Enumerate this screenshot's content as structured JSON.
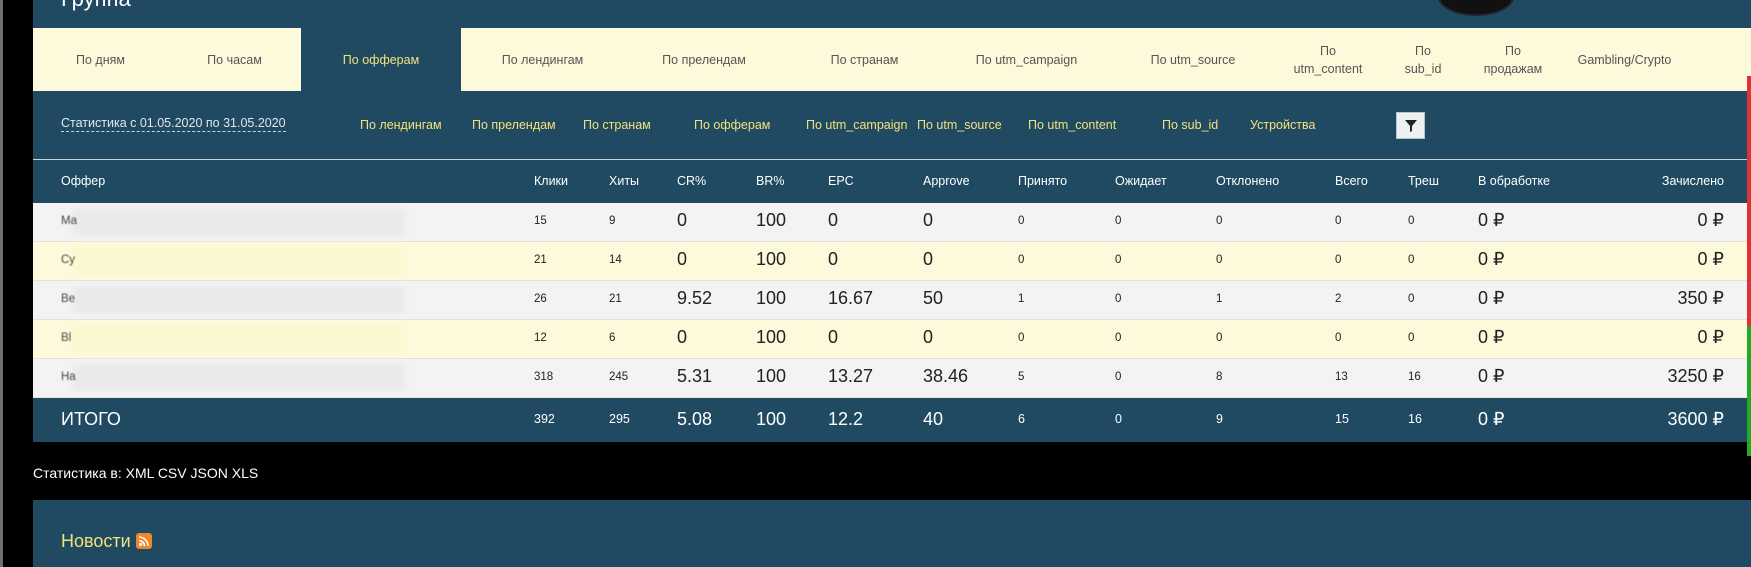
{
  "header": {
    "title": "Группа"
  },
  "tabs": [
    {
      "label": "По дням",
      "active": false
    },
    {
      "label": "По часам",
      "active": false
    },
    {
      "label": "По офферам",
      "active": true
    },
    {
      "label": "По лендингам",
      "active": false
    },
    {
      "label": "По прелендам",
      "active": false
    },
    {
      "label": "По странам",
      "active": false
    },
    {
      "label": "По utm_campaign",
      "active": false
    },
    {
      "label": "По utm_source",
      "active": false
    },
    {
      "label": "По\nutm_content",
      "active": false
    },
    {
      "label": "По\nsub_id",
      "active": false
    },
    {
      "label": "По\nпродажам",
      "active": false
    },
    {
      "label": "Gambling/Crypto",
      "active": false
    }
  ],
  "subbar": {
    "period": "Статистика с 01.05.2020 по 31.05.2020",
    "links": [
      "По лендингам",
      "По прелендам",
      "По странам",
      "По офферам",
      "По utm_campaign",
      "По utm_source",
      "По utm_content",
      "По sub_id",
      "Устройства"
    ],
    "filter_icon": "filter-icon"
  },
  "table": {
    "columns": [
      "Оффер",
      "Клики",
      "Хиты",
      "CR%",
      "BR%",
      "EPC",
      "Approve",
      "Принято",
      "Ожидает",
      "Отклонено",
      "Всего",
      "Треш",
      "В обработке",
      "Зачислено"
    ],
    "rows": [
      {
        "offer": "Ma",
        "clicks": "15",
        "hits": "9",
        "cr": "0",
        "br": "100",
        "epc": "0",
        "approve": "0",
        "accepted": "0",
        "pending": "0",
        "rejected": "0",
        "total": "0",
        "trash": "0",
        "processing": "0 ₽",
        "credited": "0 ₽"
      },
      {
        "offer": "Cy",
        "clicks": "21",
        "hits": "14",
        "cr": "0",
        "br": "100",
        "epc": "0",
        "approve": "0",
        "accepted": "0",
        "pending": "0",
        "rejected": "0",
        "total": "0",
        "trash": "0",
        "processing": "0 ₽",
        "credited": "0 ₽"
      },
      {
        "offer": "Be",
        "clicks": "26",
        "hits": "21",
        "cr": "9.52",
        "br": "100",
        "epc": "16.67",
        "approve": "50",
        "accepted": "1",
        "pending": "0",
        "rejected": "1",
        "total": "2",
        "trash": "0",
        "processing": "0 ₽",
        "credited": "350 ₽"
      },
      {
        "offer": "Bl",
        "clicks": "12",
        "hits": "6",
        "cr": "0",
        "br": "100",
        "epc": "0",
        "approve": "0",
        "accepted": "0",
        "pending": "0",
        "rejected": "0",
        "total": "0",
        "trash": "0",
        "processing": "0 ₽",
        "credited": "0 ₽"
      },
      {
        "offer": "Ha",
        "clicks": "318",
        "hits": "245",
        "cr": "5.31",
        "br": "100",
        "epc": "13.27",
        "approve": "38.46",
        "accepted": "5",
        "pending": "0",
        "rejected": "8",
        "total": "13",
        "trash": "16",
        "processing": "0 ₽",
        "credited": "3250 ₽"
      }
    ],
    "totals": {
      "label": "ИТОГО",
      "clicks": "392",
      "hits": "295",
      "cr": "5.08",
      "br": "100",
      "epc": "12.2",
      "approve": "40",
      "accepted": "6",
      "pending": "0",
      "rejected": "9",
      "total": "15",
      "trash": "16",
      "processing": "0 ₽",
      "credited": "3600 ₽"
    }
  },
  "export": {
    "label": "Статистика в:",
    "formats": [
      "XML",
      "CSV",
      "JSON",
      "XLS"
    ]
  },
  "news": {
    "title": "Новости",
    "icon": "rss-icon"
  },
  "colors": {
    "panel": "#1f4a62",
    "cream": "#fdfadc",
    "accent": "#f3e27a"
  }
}
